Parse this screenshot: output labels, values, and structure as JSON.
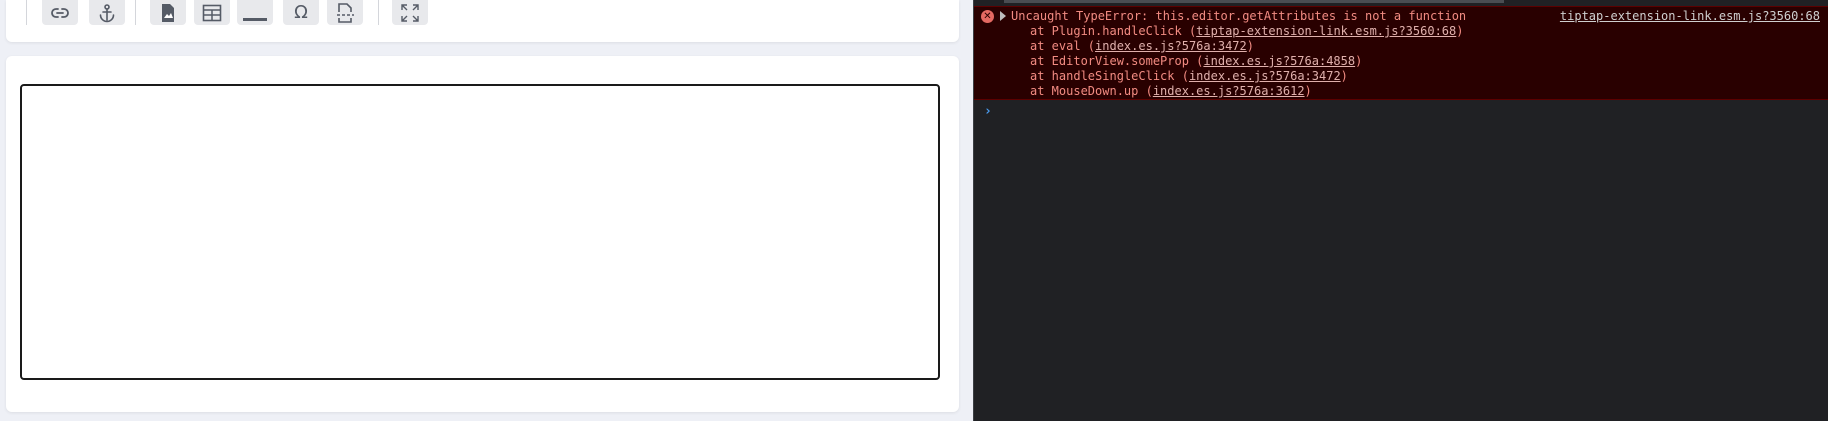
{
  "toolbar": {
    "buttons": [
      {
        "name": "link-button",
        "icon": "link-icon"
      },
      {
        "name": "anchor-button",
        "icon": "anchor-icon"
      },
      {
        "name": "insert-image-button",
        "icon": "file-image-icon"
      },
      {
        "name": "insert-table-button",
        "icon": "table-icon"
      },
      {
        "name": "horizontal-rule-button",
        "icon": "horizontal-rule-icon"
      },
      {
        "name": "special-character-button",
        "icon": "omega-icon",
        "glyph": "Ω"
      },
      {
        "name": "page-break-button",
        "icon": "page-break-icon"
      },
      {
        "name": "fullscreen-button",
        "icon": "expand-icon"
      }
    ]
  },
  "editor": {
    "content": ""
  },
  "console": {
    "error": {
      "icon_glyph": "✕",
      "message": "Uncaught TypeError: this.editor.getAttributes is not a function",
      "source": "tiptap-extension-link.esm.js?3560:68"
    },
    "stack": [
      {
        "prefix": "at Plugin.handleClick (",
        "link": "tiptap-extension-link.esm.js?3560:68",
        "suffix": ")"
      },
      {
        "prefix": "at eval (",
        "link": "index.es.js?576a:3472",
        "suffix": ")"
      },
      {
        "prefix": "at EditorView.someProp (",
        "link": "index.es.js?576a:4858",
        "suffix": ")"
      },
      {
        "prefix": "at handleSingleClick (",
        "link": "index.es.js?576a:3472",
        "suffix": ")"
      },
      {
        "prefix": "at MouseDown.up (",
        "link": "index.es.js?576a:3612",
        "suffix": ")"
      }
    ],
    "prompt_glyph": "›"
  },
  "colors": {
    "error_text": "#f28b82",
    "error_bg": "#290000",
    "console_bg": "#202124",
    "prompt": "#4a9cf0"
  }
}
